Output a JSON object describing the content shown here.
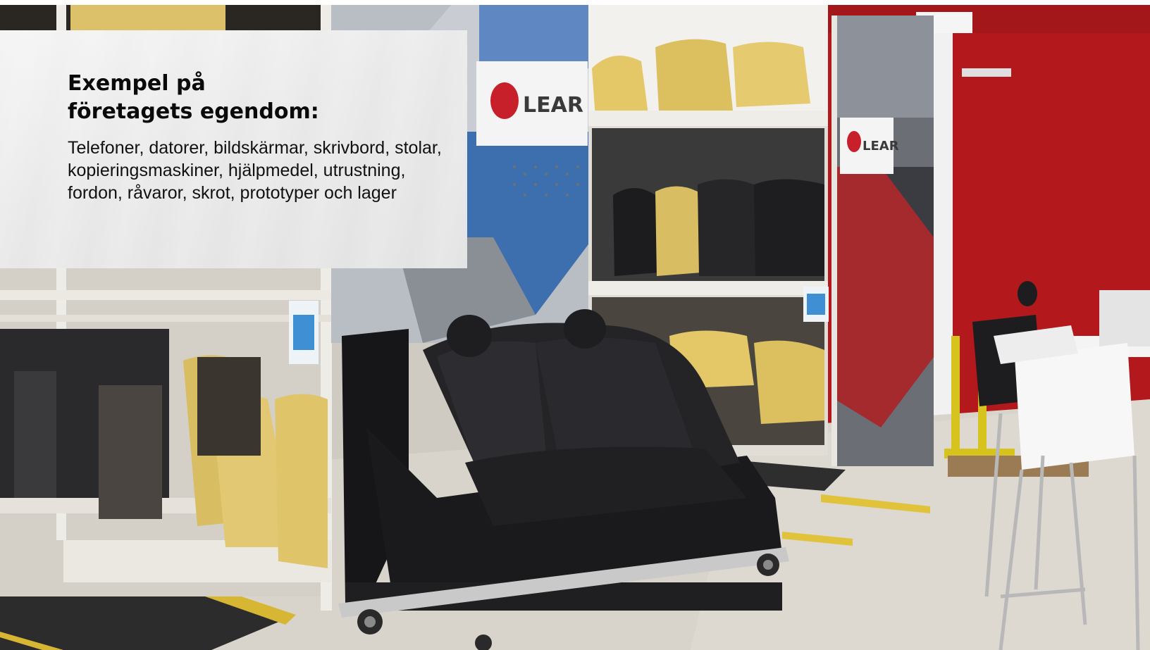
{
  "caption": {
    "title": "Exempel på\nföretagets egendom:",
    "body": "Telefoner, datorer, bildskärmar, skrivbord, stolar, kopieringsmaskiner, hjälpmedel, utrustning, fordon, råvaror, skrot, prototyper och lager"
  },
  "signs": {
    "brand_main": "LEAR",
    "brand_right": "LEAR"
  },
  "colors": {
    "wall_red": "#b3181c",
    "brand_red": "#c8202a",
    "floor": "#d9d4cb",
    "seat_black": "#1c1c1e",
    "foam_yellow": "#e0c46a",
    "shelf_white": "#e8e6e0",
    "panel_blue": "#3d6fae"
  }
}
